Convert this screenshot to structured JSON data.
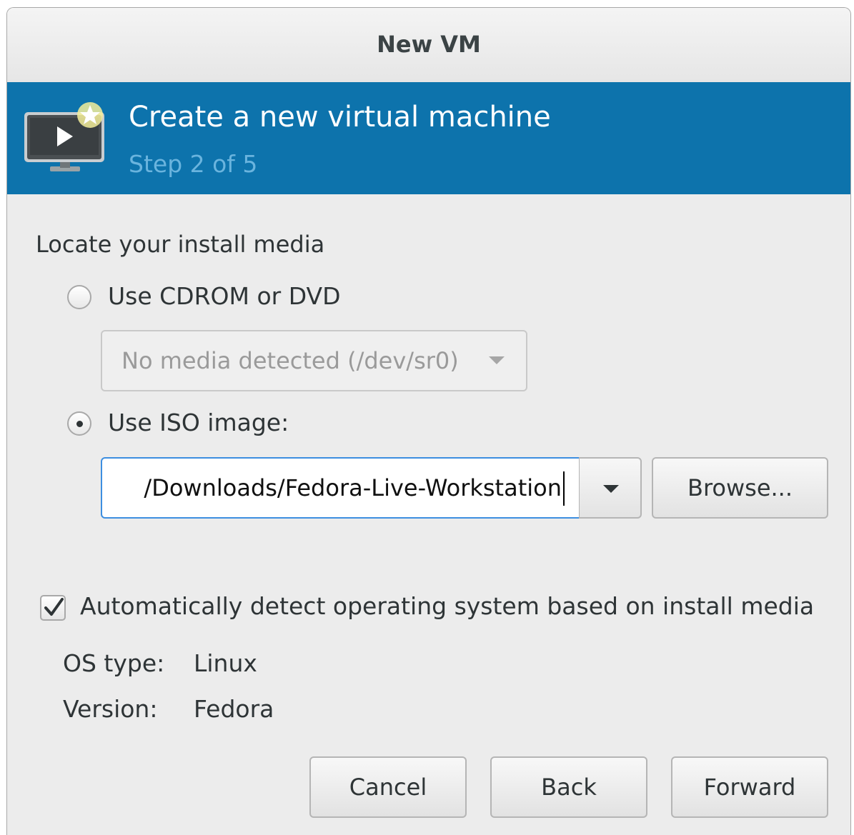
{
  "window": {
    "title": "New VM"
  },
  "banner": {
    "heading": "Create a new virtual machine",
    "step": "Step 2 of 5",
    "icon": "vm-monitor-new-icon",
    "background_color": "#0d73ac"
  },
  "install_media": {
    "section_label": "Locate your install media",
    "options": [
      {
        "label": "Use CDROM or DVD",
        "selected": false
      },
      {
        "label": "Use ISO image:",
        "selected": true
      }
    ],
    "cdrom_combo": {
      "value": "No media detected (/dev/sr0)",
      "enabled": false
    },
    "iso_entry": {
      "value": "/Downloads/Fedora-Live-Workstation",
      "focused": true
    },
    "browse_label": "Browse..."
  },
  "os_detection": {
    "auto_detect_label": "Automatically detect operating system based on install media",
    "auto_detect_checked": true,
    "os_type_label": "OS type:",
    "os_type_value": "Linux",
    "version_label": "Version:",
    "version_value": "Fedora"
  },
  "buttons": {
    "cancel": "Cancel",
    "back": "Back",
    "forward": "Forward"
  }
}
